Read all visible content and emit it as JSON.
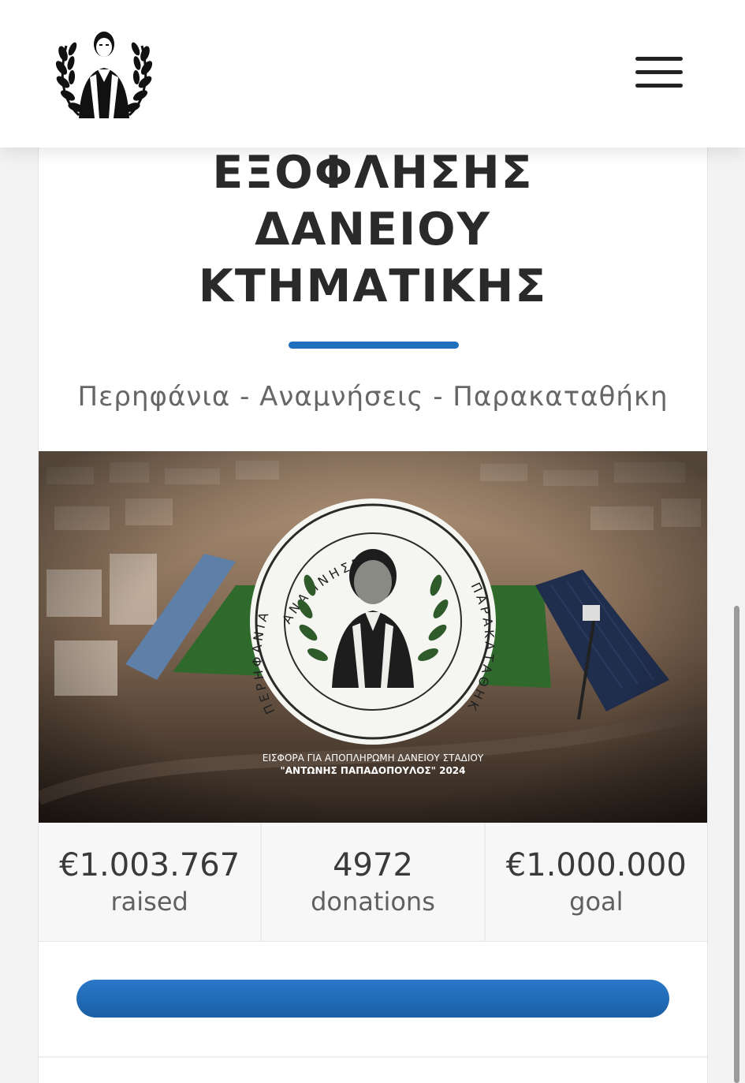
{
  "header": {
    "logo_icon": "laurel-portrait-logo",
    "menu_icon": "hamburger-menu-icon"
  },
  "campaign": {
    "title_lines": [
      "ΕΞΟΦΛΗΣΗΣ",
      "ΔΑΝΕΙΟΥ",
      "ΚΤΗΜΑΤΙΚΗΣ"
    ],
    "subtitle": "Περηφάνια - Αναμνήσεις - Παρακαταθήκη",
    "accent_color": "#1f6fbd"
  },
  "banner": {
    "seal_text": "ΑΝΑΜΝΗΣΕΙΣ · ΠΑΡΑΚΑΤΑΘΗΚΗ · ΠΕΡΗΦΑΝΙΑ",
    "caption_line1": "ΕΙΣΦΟΡΑ ΓΙΑ ΑΠΟΠΛΗΡΩΜΗ ΔΑΝΕΙΟΥ ΣΤΑΔΙΟΥ",
    "caption_line2": "\"ΑΝΤΩΝΗΣ ΠΑΠΑΔΟΠΟΥΛΟΣ\" 2024"
  },
  "stats": [
    {
      "value": "€1.003.767",
      "label": "raised"
    },
    {
      "value": "4972",
      "label": "donations"
    },
    {
      "value": "€1.000.000",
      "label": "goal"
    }
  ],
  "progress": {
    "fraction": 1.0,
    "color": "#1f6fbd"
  }
}
